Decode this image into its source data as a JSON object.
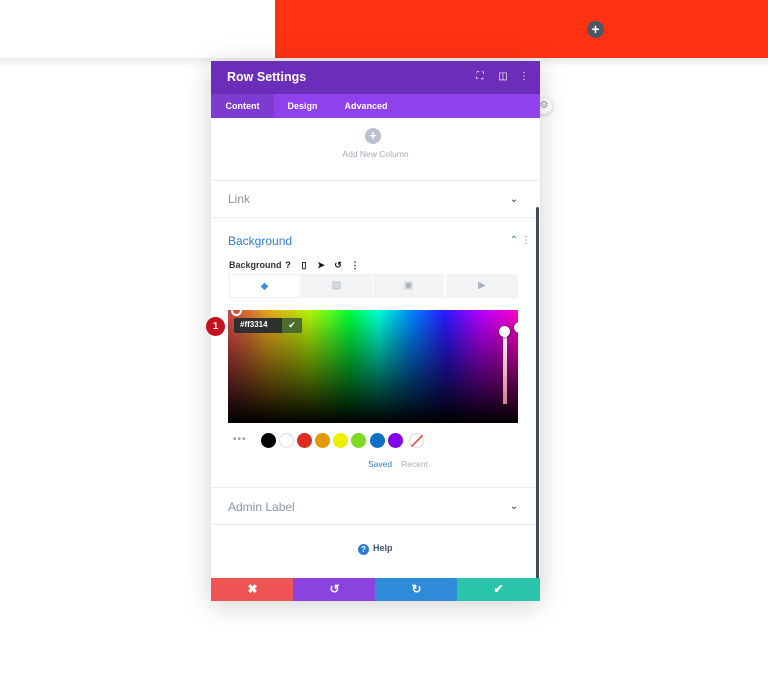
{
  "page": {
    "top_bar_color": "#ff3314",
    "top_add_icon": "plus-icon"
  },
  "modal": {
    "title": "Row Settings",
    "header_icons": [
      "fullscreen-icon",
      "split-view-icon",
      "more-options-icon"
    ],
    "tabs": [
      {
        "label": "Content",
        "active": true
      },
      {
        "label": "Design",
        "active": false
      },
      {
        "label": "Advanced",
        "active": false
      }
    ],
    "add_column": {
      "label": "Add New Column"
    },
    "sections": {
      "link": {
        "title": "Link"
      },
      "background": {
        "title": "Background"
      },
      "admin_label": {
        "title": "Admin Label"
      }
    },
    "background": {
      "label": "Background",
      "tools": [
        "help-icon",
        "mobile-icon",
        "cursor-icon",
        "reset-icon",
        "more-options-icon"
      ],
      "type_tabs": [
        "color-fill-icon",
        "gradient-icon",
        "image-icon",
        "video-icon"
      ],
      "hex_value": "#ff3314",
      "swatches": [
        "#000000",
        "#ffffff",
        "#e02b20",
        "#e09900",
        "#edf000",
        "#7cda24",
        "#0c71c3",
        "#8300e9",
        "none"
      ],
      "palette_modes": {
        "saved": "Saved",
        "recent": "Recent"
      }
    },
    "help": {
      "label": "Help"
    },
    "footer": {
      "buttons": [
        {
          "icon": "close-icon",
          "glyph": "✖",
          "color": "#ef5555"
        },
        {
          "icon": "undo-icon",
          "glyph": "↺",
          "color": "#8b43df"
        },
        {
          "icon": "redo-icon",
          "glyph": "↻",
          "color": "#2f8ad8"
        },
        {
          "icon": "save-check-icon",
          "glyph": "✔",
          "color": "#29c4a9"
        }
      ]
    }
  },
  "annotation": {
    "marker": "1"
  },
  "colors": {
    "header": "#6c2eb9",
    "tabs": "#8f42ec",
    "accent_blue": "#2e7cd6"
  }
}
